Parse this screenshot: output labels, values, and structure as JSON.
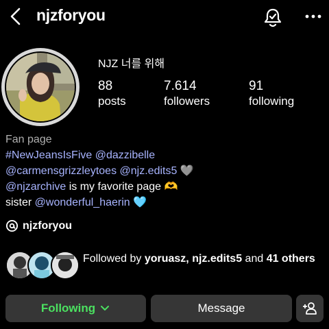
{
  "header": {
    "username": "njzforyou"
  },
  "profile": {
    "display_name": "NJZ 너를 위해",
    "stats": [
      {
        "value": "88",
        "label": "posts"
      },
      {
        "value": "7.614",
        "label": "followers"
      },
      {
        "value": "91",
        "label": "following"
      }
    ],
    "bio": {
      "category": "Fan page",
      "line1_link1": "#NewJeansIsFive",
      "line1_link2": "@dazzibelle",
      "line2_link1": "@carmensgrizzleytoes",
      "line2_link2": "@njz.edits5",
      "line2_emoji": "🩶",
      "line3_link": "@njzarchive",
      "line3_text": " is my favorite page ",
      "line3_emoji": "🫶",
      "line4_text": "sister ",
      "line4_link": "@wonderful_haerin",
      "line4_emoji": "🩵"
    },
    "threads_handle": "njzforyou"
  },
  "followed_by": {
    "prefix": "Followed by ",
    "names": "yoruasz, njz.edits5",
    "middle": " and ",
    "count_text": "41 others"
  },
  "actions": {
    "following_label": "Following",
    "message_label": "Message"
  },
  "colors": {
    "background": "#000000",
    "link": "#a8b4ff",
    "following_green": "#4be160",
    "button_bg": "#363636"
  },
  "icons": [
    "back-arrow-icon",
    "notification-bell-icon",
    "more-options-icon",
    "threads-icon",
    "chevron-down-icon",
    "add-person-icon"
  ]
}
